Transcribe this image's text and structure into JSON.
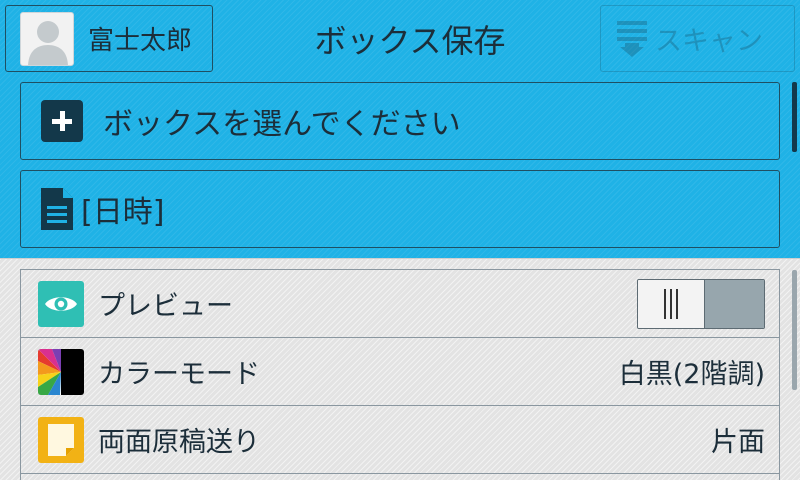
{
  "header": {
    "user_name": "富士太郎",
    "title": "ボックス保存",
    "scan_label": "スキャン"
  },
  "fields": {
    "box_select": "ボックスを選んでください",
    "date_label": "[日時]"
  },
  "settings": {
    "preview": {
      "label": "プレビュー",
      "enabled": false
    },
    "color_mode": {
      "label": "カラーモード",
      "value": "白黒(2階調)"
    },
    "duplex": {
      "label": "両面原稿送り",
      "value": "片面"
    }
  },
  "colors": {
    "accent": "#1fb2e6",
    "dark": "#13384a",
    "panel": "#e3e3e3"
  }
}
